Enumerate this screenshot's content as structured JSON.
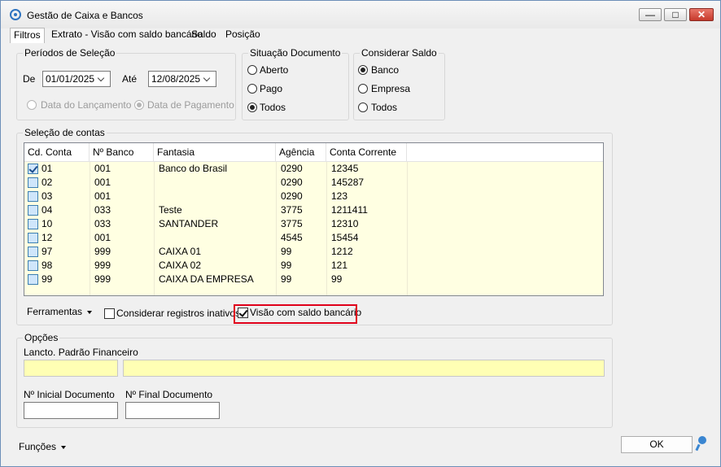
{
  "window": {
    "title": "Gestão de Caixa e Bancos",
    "min_label": "—",
    "max_label": "□",
    "close_label": "✕"
  },
  "tabs": [
    {
      "label": "Filtros",
      "active": true
    },
    {
      "label": "Extrato - Visão com saldo bancário"
    },
    {
      "label": "Saldo"
    },
    {
      "label": "Posição"
    }
  ],
  "periodos": {
    "legend": "Períodos de Seleção",
    "de_label": "De",
    "de_value": "01/01/2025",
    "ate_label": "Até",
    "ate_value": "12/08/2025",
    "data_lancamento": "Data do Lançamento",
    "data_pagamento": "Data de Pagamento",
    "selected": "Data de Pagamento"
  },
  "situacao": {
    "legend": "Situação Documento",
    "options": [
      "Aberto",
      "Pago",
      "Todos"
    ],
    "selected": "Todos"
  },
  "considerar_saldo": {
    "legend": "Considerar Saldo",
    "options": [
      "Banco",
      "Empresa",
      "Todos"
    ],
    "selected": "Banco"
  },
  "contas": {
    "legend": "Seleção de contas",
    "columns": [
      "Cd. Conta",
      "Nº Banco",
      "Fantasia",
      "Agência",
      "Conta Corrente"
    ],
    "rows": [
      {
        "checked": true,
        "cd": "01",
        "banco": "001",
        "fantasia": "Banco do Brasil",
        "agencia": "0290",
        "conta": "12345"
      },
      {
        "checked": false,
        "cd": "02",
        "banco": "001",
        "fantasia": "",
        "agencia": "0290",
        "conta": "145287"
      },
      {
        "checked": false,
        "cd": "03",
        "banco": "001",
        "fantasia": "",
        "agencia": "0290",
        "conta": "123"
      },
      {
        "checked": false,
        "cd": "04",
        "banco": "033",
        "fantasia": "Teste",
        "agencia": "3775",
        "conta": "1211411"
      },
      {
        "checked": false,
        "cd": "10",
        "banco": "033",
        "fantasia": "SANTANDER",
        "agencia": "3775",
        "conta": "12310"
      },
      {
        "checked": false,
        "cd": "12",
        "banco": "001",
        "fantasia": "",
        "agencia": "4545",
        "conta": "15454"
      },
      {
        "checked": false,
        "cd": "97",
        "banco": "999",
        "fantasia": "CAIXA 01",
        "agencia": "99",
        "conta": "1212"
      },
      {
        "checked": false,
        "cd": "98",
        "banco": "999",
        "fantasia": "CAIXA 02",
        "agencia": "99",
        "conta": "121"
      },
      {
        "checked": false,
        "cd": "99",
        "banco": "999",
        "fantasia": "CAIXA DA EMPRESA",
        "agencia": "99",
        "conta": "99"
      }
    ],
    "ferramentas_label": "Ferramentas",
    "inativos_label": "Considerar registros inativos",
    "inativos_checked": false,
    "visao_label": "Visão com saldo bancário",
    "visao_checked": true
  },
  "opcoes": {
    "legend": "Opções",
    "lancto_label": "Lancto. Padrão Financeiro",
    "lancto_code": "",
    "lancto_desc": "",
    "inicial_label": "Nº Inicial Documento",
    "inicial_value": "",
    "final_label": "Nº Final Documento",
    "final_value": ""
  },
  "footer": {
    "funcoes_label": "Funções",
    "ok_label": "OK"
  },
  "colors": {
    "highlight": "#e0001a",
    "grid_row_bg": "#ffffe2",
    "input_yellow": "#ffffb4"
  }
}
